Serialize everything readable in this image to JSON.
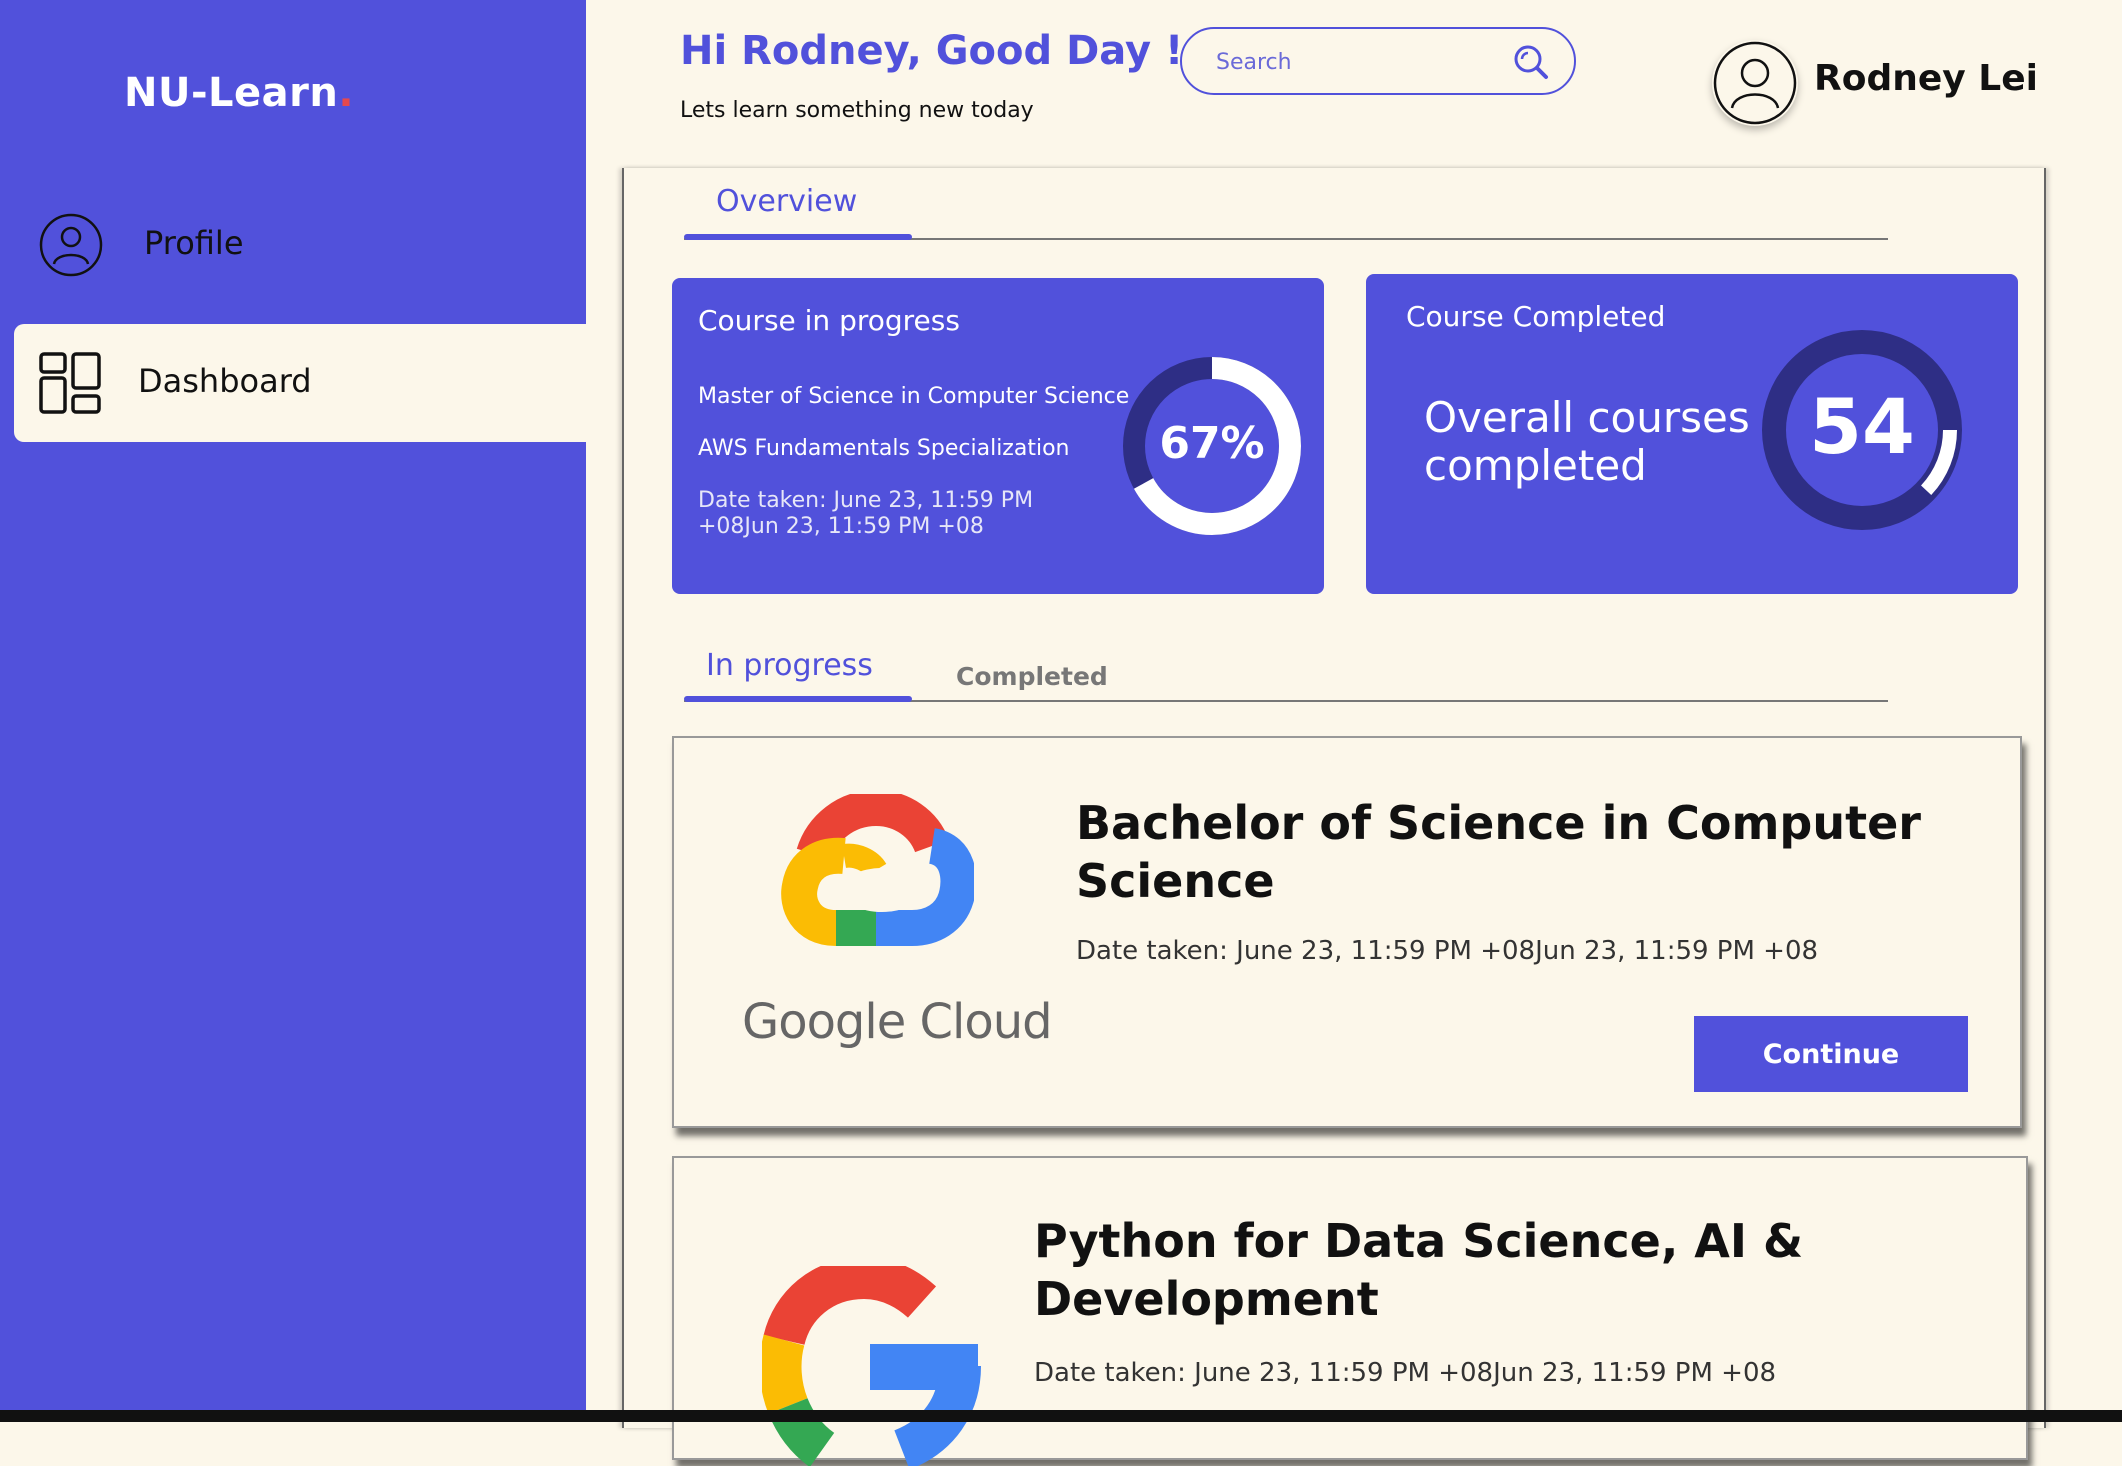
{
  "app": {
    "brand_name": "NU-Learn",
    "brand_dot": ".",
    "colors": {
      "primary": "#5151DB",
      "background": "#FCF7EA",
      "accent_dot": "#E5484D"
    }
  },
  "sidebar": {
    "items": [
      {
        "label": "Profile",
        "icon": "user-circle-icon",
        "active": false
      },
      {
        "label": "Dashboard",
        "icon": "dashboard-grid-icon",
        "active": true
      }
    ]
  },
  "header": {
    "greeting": "Hi Rodney, Good Day !",
    "subtitle": "Lets learn something new today",
    "search_placeholder": "Search",
    "user_name": "Rodney Lei"
  },
  "overview": {
    "tab_label": "Overview",
    "in_progress_card": {
      "title": "Course in progress",
      "courses": [
        "Master of Science in Computer Science",
        "AWS Fundamentals Specialization"
      ],
      "date": "Date taken: June 23, 11:59 PM +08Jun 23, 11:59 PM +08",
      "progress_percent": 67,
      "progress_label": "67%"
    },
    "completed_card": {
      "title": "Course Completed",
      "text": "Overall courses completed",
      "count_label": "54",
      "ring_fraction": 0.12
    }
  },
  "course_tabs": {
    "active": "In progress",
    "inactive": "Completed"
  },
  "courses": [
    {
      "title": "Bachelor of Science in Computer Science",
      "date": "Date taken: June 23, 11:59 PM +08Jun 23, 11:59 PM +08",
      "logo": "google-cloud-logo",
      "logo_text": "Google Cloud",
      "button_label": "Continue"
    },
    {
      "title": "Python for Data Science, AI & Development",
      "date": "Date taken: June 23, 11:59 PM +08Jun 23, 11:59 PM +08",
      "logo": "google-g-logo"
    }
  ]
}
